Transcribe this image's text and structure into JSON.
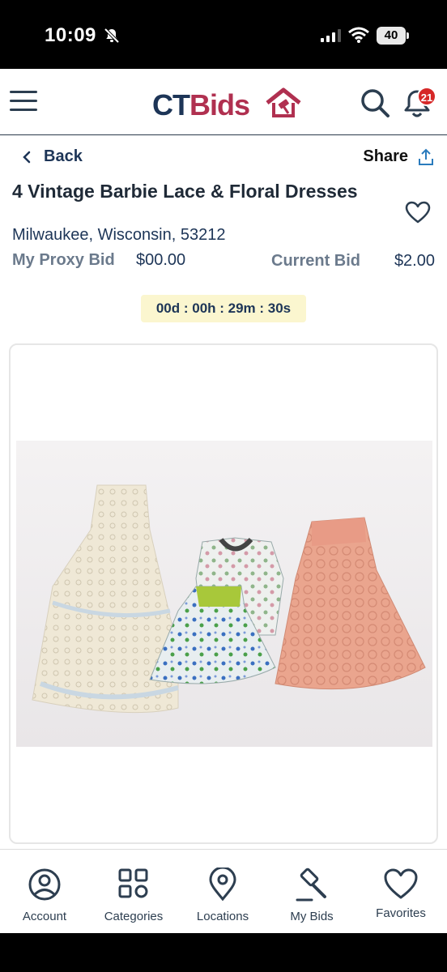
{
  "status_bar": {
    "time": "10:09",
    "battery": "40"
  },
  "header": {
    "logo_ct": "CT",
    "logo_bids": "Bids",
    "notification_count": "21"
  },
  "nav": {
    "back_label": "Back",
    "share_label": "Share"
  },
  "listing": {
    "title": "4 Vintage Barbie Lace & Floral Dresses",
    "location": "Milwaukee, Wisconsin, 53212",
    "proxy_bid_label": "My Proxy Bid",
    "proxy_bid_value": "$00.00",
    "current_bid_label": "Current Bid",
    "current_bid_value": "$2.00",
    "countdown": "00d : 00h : 29m : 30s"
  },
  "tabs": [
    {
      "label": "Account",
      "icon": "account-icon"
    },
    {
      "label": "Categories",
      "icon": "categories-icon"
    },
    {
      "label": "Locations",
      "icon": "location-pin-icon"
    },
    {
      "label": "My Bids",
      "icon": "gavel-icon"
    },
    {
      "label": "Favorites",
      "icon": "heart-icon"
    }
  ],
  "colors": {
    "brand_navy": "#1d3557",
    "brand_red": "#b03050",
    "timer_bg": "#fbf6cf",
    "badge": "#d62828"
  }
}
